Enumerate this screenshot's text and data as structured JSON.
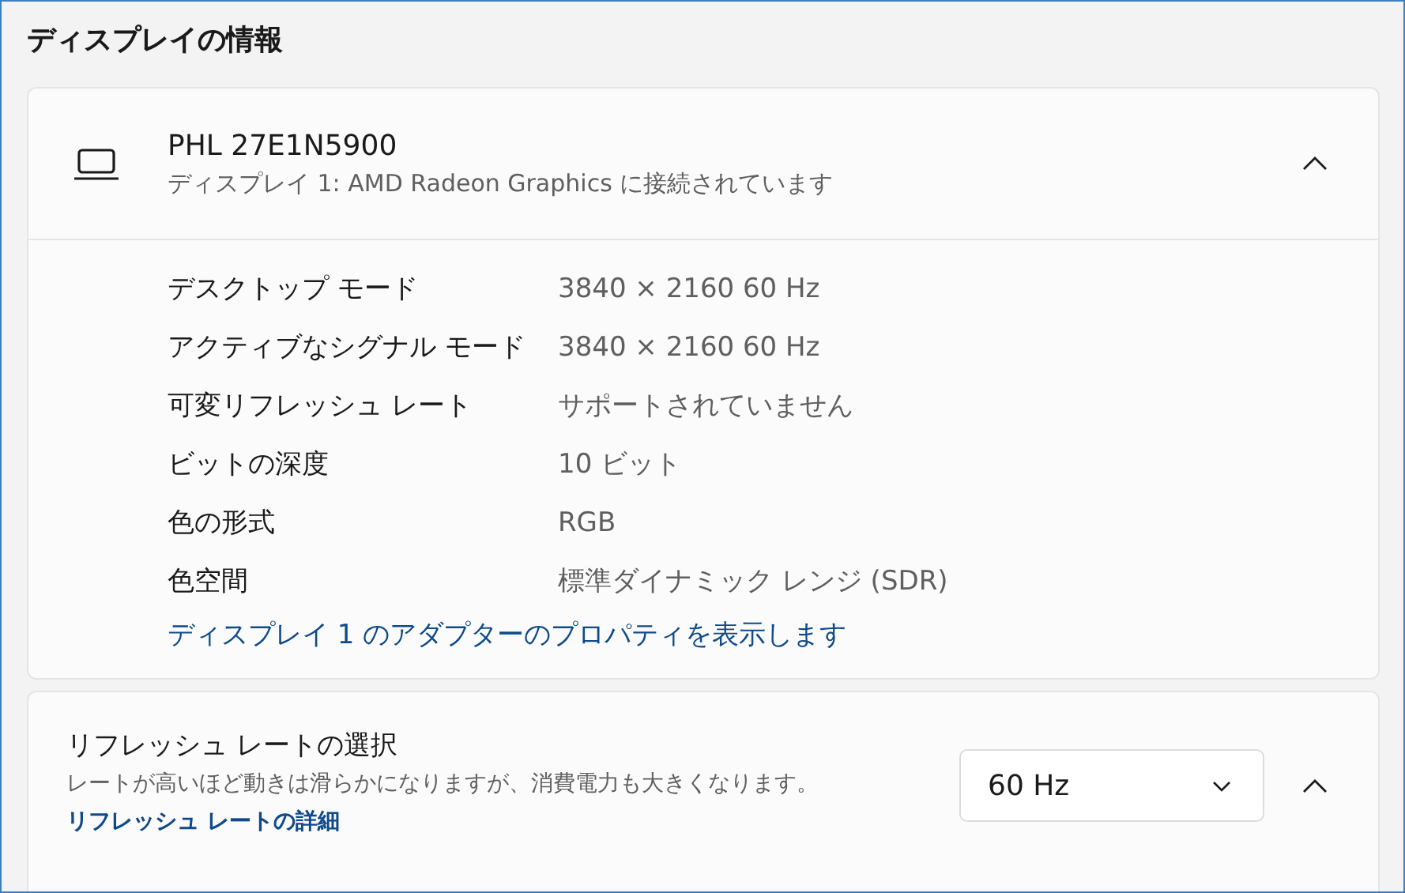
{
  "title": "ディスプレイの情報",
  "display_card": {
    "name": "PHL 27E1N5900",
    "subtitle": "ディスプレイ 1: AMD Radeon Graphics に接続されています",
    "expanded": true,
    "properties": [
      {
        "label": "デスクトップ モード",
        "value": "3840 × 2160 60 Hz"
      },
      {
        "label": "アクティブなシグナル モード",
        "value": "3840 × 2160 60 Hz"
      },
      {
        "label": "可変リフレッシュ レート",
        "value": "サポートされていません"
      },
      {
        "label": "ビットの深度",
        "value": "10 ビット"
      },
      {
        "label": "色の形式",
        "value": "RGB"
      },
      {
        "label": "色空間",
        "value": "標準ダイナミック レンジ (SDR)"
      }
    ],
    "link": "ディスプレイ 1 のアダプターのプロパティを表示します"
  },
  "refresh_card": {
    "title": "リフレッシュ レートの選択",
    "description": "レートが高いほど動きは滑らかになりますが、消費電力も大きくなります。",
    "link": "リフレッシュ レートの詳細",
    "dropdown_value": "60 Hz",
    "expanded": true
  }
}
